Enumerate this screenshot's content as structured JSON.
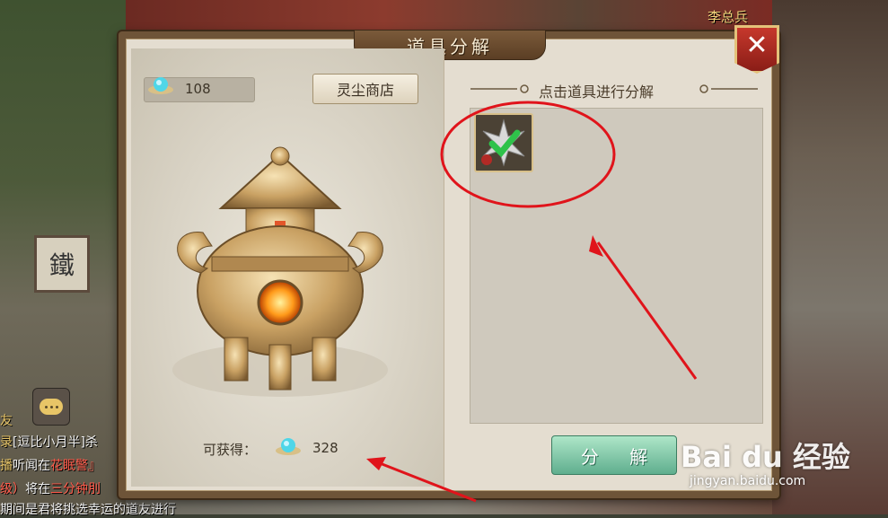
{
  "dialog": {
    "title": "道具分解",
    "close_label": "✕"
  },
  "left": {
    "dust_count": "108",
    "shop_button": "灵尘商店",
    "gain_label": "可获得：",
    "gain_value": "328"
  },
  "right": {
    "title": "点击道具进行分解",
    "decompose_button": "分 解"
  },
  "world": {
    "npc_name": "李总兵",
    "shop_sign": "鐵",
    "chat": [
      {
        "prefix": "录",
        "prefix_color": "#e8c567",
        "text": "[逗比小月半]杀"
      },
      {
        "prefix": "播",
        "prefix_color": "#e8c567",
        "text": "听闻在",
        "highlight": "花眠警』"
      },
      {
        "prefix": "级）",
        "prefix_color": "#ff5a4a",
        "text": "将在",
        "highlight": "三分钟刖"
      },
      {
        "prefix": "",
        "prefix_color": "#e8c567",
        "text": "期间是君将挑选幸运的道友进行"
      }
    ],
    "side_label": "友"
  },
  "watermark": {
    "brand": "Bai du 经验",
    "url": "jingyan.baidu.com"
  },
  "colors": {
    "annotation": "#e0141b",
    "button_green": "#5fae8e",
    "close_red": "#c6382c"
  }
}
